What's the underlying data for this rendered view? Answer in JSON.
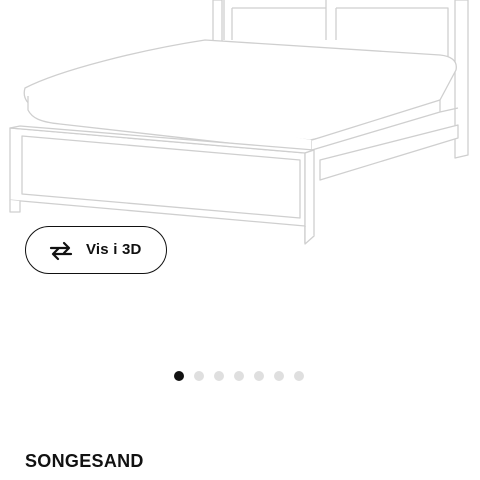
{
  "product": {
    "name": "SONGESAND",
    "image_alt_icon": "bed-image"
  },
  "view3d": {
    "label": "Vis i 3D",
    "icon": "rotate-3d-icon"
  },
  "carousel": {
    "total": 7,
    "active_index": 0
  },
  "colors": {
    "text": "#111111",
    "dot_active": "#111111",
    "dot_inactive": "#dfdfdf",
    "bed_outline": "#cfcfcf"
  }
}
